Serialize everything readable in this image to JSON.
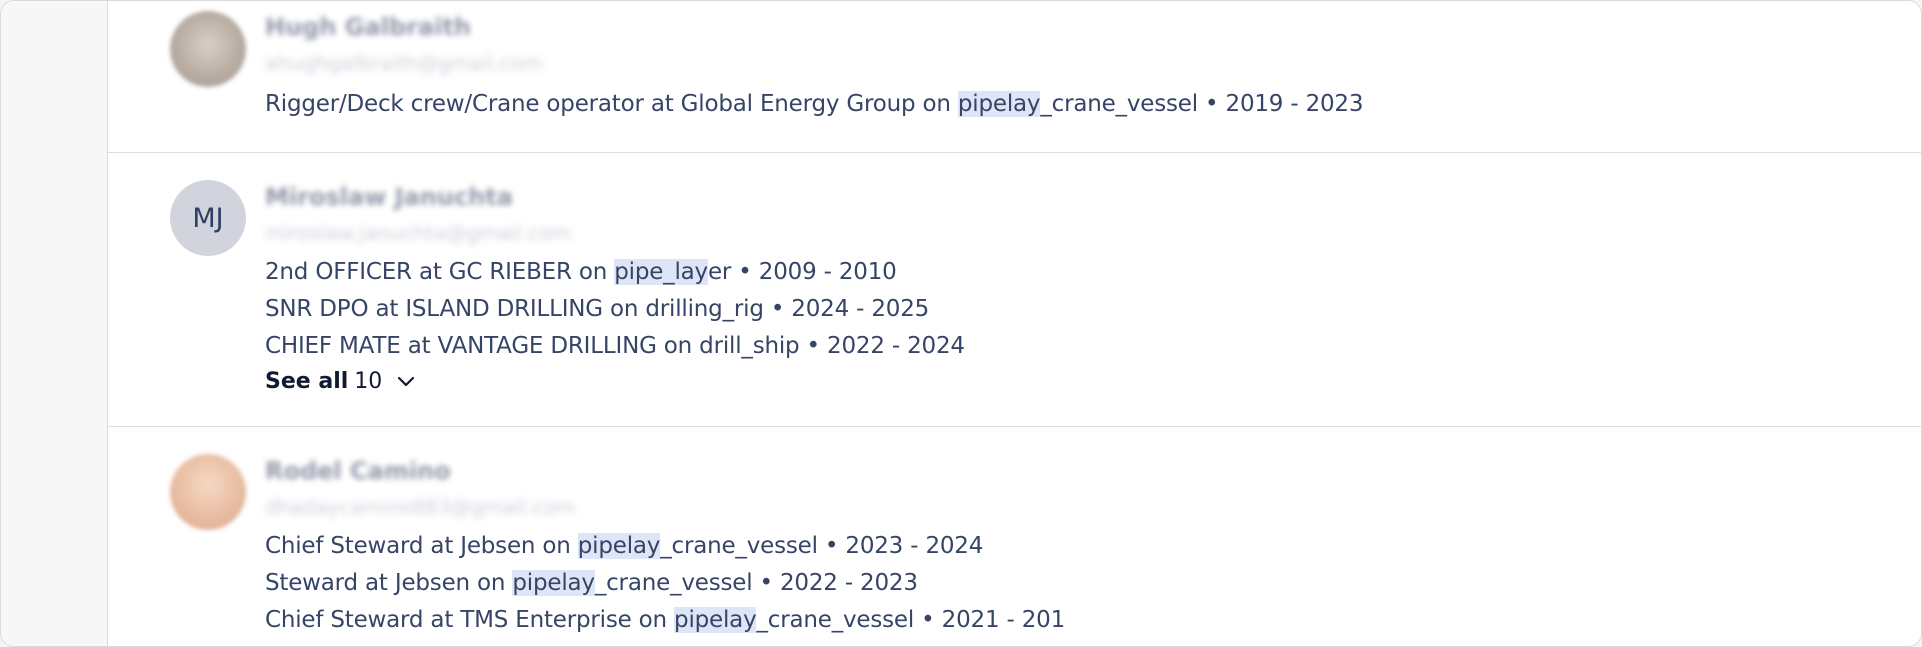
{
  "candidates": [
    {
      "name": "Hugh Galbraith",
      "email": "ahughgalbraith@gmail.com",
      "experiences": [
        {
          "pre": "Rigger/Deck crew/Crane operator at Global Energy Group on ",
          "hl": "pipelay",
          "post": "_crane_vessel • 2019 - 2023"
        }
      ]
    },
    {
      "initials": "MJ",
      "name": "Miroslaw Januchta",
      "email": "miroslaw.januchta@gmail.com",
      "experiences": [
        {
          "pre": "2nd OFFICER at GC RIEBER on ",
          "hl": "pipe_lay",
          "post": "er • 2009 - 2010"
        },
        {
          "pre": "SNR DPO at ISLAND DRILLING on drilling_rig • 2024 - 2025",
          "hl": "",
          "post": ""
        },
        {
          "pre": "CHIEF MATE at VANTAGE DRILLING on drill_ship • 2022 - 2024",
          "hl": "",
          "post": ""
        }
      ],
      "see_all_label": "See all",
      "see_all_count": "10"
    },
    {
      "name": "Rodel Camino",
      "email": "dhadaycamino883@gmail.com",
      "experiences": [
        {
          "pre": "Chief Steward at Jebsen on ",
          "hl": "pipelay",
          "post": "_crane_vessel • 2023 - 2024"
        },
        {
          "pre": "Steward at Jebsen on ",
          "hl": "pipelay",
          "post": "_crane_vessel • 2022 - 2023"
        },
        {
          "pre": "Chief Steward at TMS Enterprise on ",
          "hl": "pipelay",
          "post": "_crane_vessel • 2021 - 201"
        }
      ]
    }
  ],
  "icons": {
    "see_all_toggle": "chevron-down-icon"
  },
  "colors": {
    "highlight": "#dde5f7",
    "avatar_bg": "#d1d4dc",
    "text": "#364466"
  }
}
